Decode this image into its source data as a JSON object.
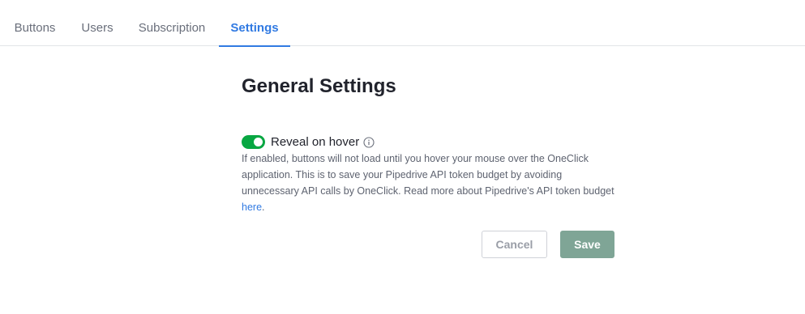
{
  "tabs": [
    {
      "label": "Buttons"
    },
    {
      "label": "Users"
    },
    {
      "label": "Subscription"
    },
    {
      "label": "Settings",
      "active": true
    }
  ],
  "page": {
    "title": "General Settings"
  },
  "setting": {
    "toggle_on": true,
    "label": "Reveal on hover",
    "info_icon": "info-circle-icon",
    "description": "If enabled, buttons will not load until you hover your mouse over the OneClick application. This is to save your Pipedrive API token budget by avoiding unnecessary API calls by OneClick. Read more about Pipedrive's API token budget ",
    "link_text": "here",
    "description_end": "."
  },
  "actions": {
    "cancel_label": "Cancel",
    "save_label": "Save"
  },
  "colors": {
    "accent": "#317ae2",
    "toggle_on": "#08a742",
    "save_button": "#7fa596"
  }
}
